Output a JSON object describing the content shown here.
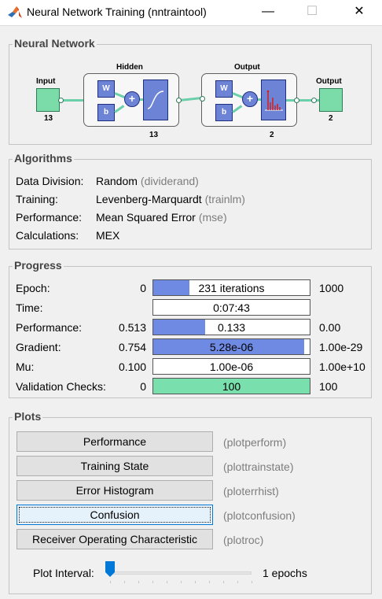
{
  "window": {
    "title": "Neural Network Training (nntraintool)",
    "min_glyph": "—",
    "max_glyph": "☐",
    "close_glyph": "✕"
  },
  "network": {
    "section_title": "Neural Network",
    "input_label": "Input",
    "input_size": "13",
    "hidden_label": "Hidden",
    "hidden_size": "13",
    "output_layer_label": "Output",
    "output_layer_size": "2",
    "output_label": "Output",
    "output_size": "2",
    "w_label": "W",
    "b_label": "b",
    "sum_glyph": "+"
  },
  "algorithms": {
    "section_title": "Algorithms",
    "rows": [
      {
        "label": "Data Division:",
        "value": "Random",
        "fn": "(dividerand)"
      },
      {
        "label": "Training:",
        "value": "Levenberg-Marquardt",
        "fn": "(trainlm)"
      },
      {
        "label": "Performance:",
        "value": "Mean Squared Error",
        "fn": "(mse)"
      },
      {
        "label": "Calculations:",
        "value": "MEX",
        "fn": ""
      }
    ]
  },
  "progress": {
    "section_title": "Progress",
    "rows": [
      {
        "label": "Epoch:",
        "min": "0",
        "current": "231 iterations",
        "max": "1000",
        "fill": 0.231,
        "color": "#6f8ae3"
      },
      {
        "label": "Time:",
        "min": "",
        "current": "0:07:43",
        "max": "",
        "fill": 0,
        "color": "#6f8ae3"
      },
      {
        "label": "Performance:",
        "min": "0.513",
        "current": "0.133",
        "max": "0.00",
        "fill": 0.33,
        "color": "#6f8ae3"
      },
      {
        "label": "Gradient:",
        "min": "0.754",
        "current": "5.28e-06",
        "max": "1.00e-29",
        "fill": 0.965,
        "color": "#6f8ae3"
      },
      {
        "label": "Mu:",
        "min": "0.100",
        "current": "1.00e-06",
        "max": "1.00e+10",
        "fill": 0,
        "color": "#6f8ae3"
      },
      {
        "label": "Validation Checks:",
        "min": "0",
        "current": "100",
        "max": "100",
        "fill": 1.0,
        "color": "#79dfac"
      }
    ]
  },
  "plots": {
    "section_title": "Plots",
    "buttons": [
      {
        "label": "Performance",
        "fn": "(plotperform)"
      },
      {
        "label": "Training State",
        "fn": "(plottrainstate)"
      },
      {
        "label": "Error Histogram",
        "fn": "(ploterrhist)"
      },
      {
        "label": "Confusion",
        "fn": "(plotconfusion)"
      },
      {
        "label": "Receiver Operating Characteristic",
        "fn": "(plotroc)"
      }
    ],
    "interval_label": "Plot Interval:",
    "interval_value": "1 epochs",
    "interval_level": 0
  }
}
